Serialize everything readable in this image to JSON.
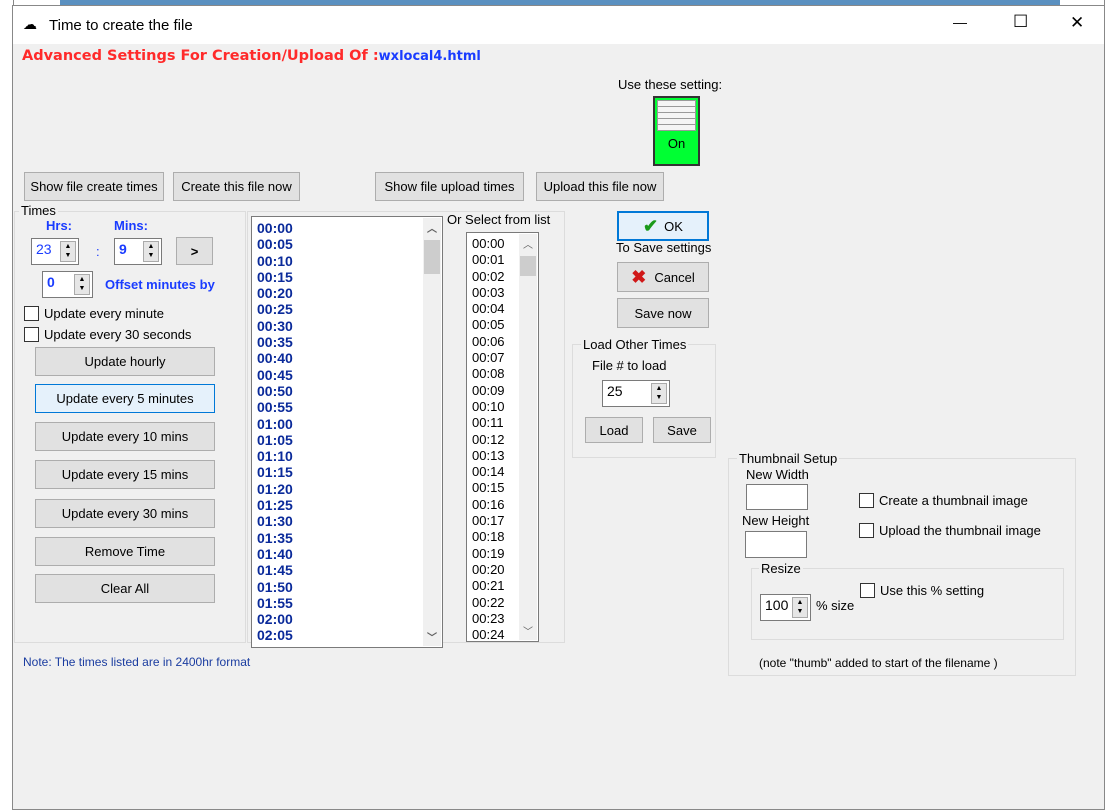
{
  "window": {
    "title": "Time to create the file",
    "controls": {
      "minimize": "—",
      "maximize": "☐",
      "close": "✕"
    }
  },
  "header": {
    "prefix": "Advanced Settings For Creation/Upload Of :",
    "filename": "wxlocal4.html",
    "prefix_color": "#ff2a2a",
    "filename_color": "#1a3cff"
  },
  "use_setting": {
    "label": "Use these setting:",
    "state": "On",
    "color": "#00ff33"
  },
  "buttons": {
    "show_create": "Show file create times",
    "create_now": "Create this file now",
    "show_upload": "Show file upload times",
    "upload_now": "Upload this file now",
    "ok": "OK",
    "to_save": "To Save settings",
    "cancel": "Cancel",
    "save_now": "Save now"
  },
  "times": {
    "legend": "Times",
    "hrs_label": "Hrs:",
    "mins_label": "Mins:",
    "hrs": "23",
    "colon": ":",
    "mins": "9",
    "next": ">",
    "offset": "0",
    "offset_label": "Offset minutes by",
    "update_every_minute": "Update every minute",
    "update_every_30s": "Update every 30 seconds",
    "actions": [
      "Update hourly",
      "Update every 5 minutes",
      "Update every 10 mins",
      "Update every 15 mins",
      "Update every 30 mins",
      "Remove Time",
      "Clear All"
    ]
  },
  "time_list": [
    "00:00",
    "00:05",
    "00:10",
    "00:15",
    "00:20",
    "00:25",
    "00:30",
    "00:35",
    "00:40",
    "00:45",
    "00:50",
    "00:55",
    "01:00",
    "01:05",
    "01:10",
    "01:15",
    "01:20",
    "01:25",
    "01:30",
    "01:35",
    "01:40",
    "01:45",
    "01:50",
    "01:55",
    "02:00",
    "02:05"
  ],
  "select_list": {
    "label": "Or Select from list",
    "items": [
      "00:00",
      "00:01",
      "00:02",
      "00:03",
      "00:04",
      "00:05",
      "00:06",
      "00:07",
      "00:08",
      "00:09",
      "00:10",
      "00:11",
      "00:12",
      "00:13",
      "00:14",
      "00:15",
      "00:16",
      "00:17",
      "00:18",
      "00:19",
      "00:20",
      "00:21",
      "00:22",
      "00:23",
      "00:24"
    ]
  },
  "load_other": {
    "legend": "Load Other Times",
    "file_label": "File # to load",
    "file_num": "25",
    "load": "Load",
    "save": "Save"
  },
  "thumbnail": {
    "legend": "Thumbnail Setup",
    "new_width": "New Width",
    "new_height": "New Height",
    "create": "Create a thumbnail image",
    "upload": "Upload the thumbnail image",
    "resize_legend": "Resize",
    "percent": "100",
    "percent_label": "% size",
    "use_percent": "Use this % setting",
    "note": "(note \"thumb\" added to start of the filename )"
  },
  "note": "Note: The times listed are in 2400hr format"
}
